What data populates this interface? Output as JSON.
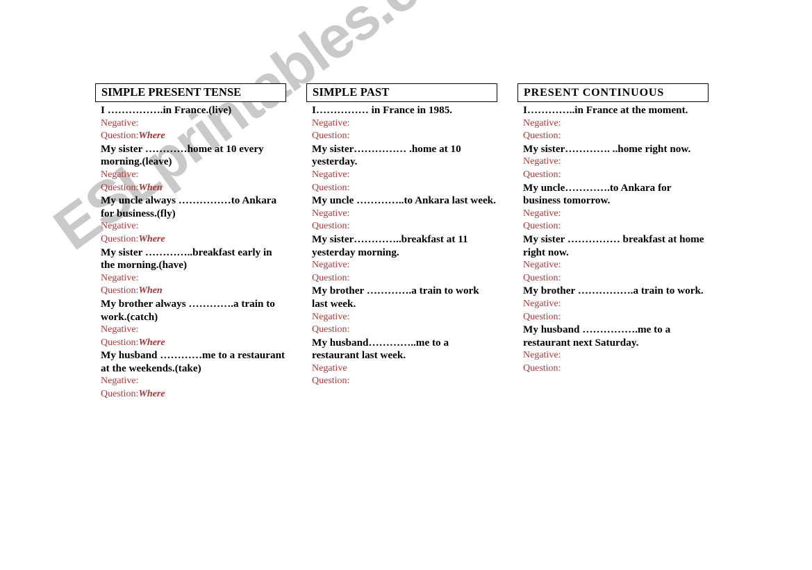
{
  "watermark": {
    "text": "ESLprintables.com"
  },
  "colors": {
    "prompt_red": "#b03a3a",
    "question_word_red": "#a83232",
    "text_black": "#000000",
    "border_black": "#000000",
    "watermark_gray": "#c9c9c9",
    "page_background": "#ffffff"
  },
  "columns": [
    {
      "header": "SIMPLE PRESENT TENSE",
      "entries": [
        {
          "sentence": "I …………….in France.(live)",
          "negative_label": "Negative:",
          "question_label": "Question:",
          "question_word": "Where"
        },
        {
          "sentence": "My sister …………home at 10 every morning.(leave)",
          "negative_label": "Negative:",
          "question_label": "Question:",
          "question_word": "When"
        },
        {
          "sentence": "My uncle always ……………to Ankara for business.(fly)",
          "negative_label": "Negative:",
          "question_label": "Question:",
          "question_word": "Where"
        },
        {
          "sentence": "My sister …………..breakfast early in the morning.(have)",
          "negative_label": "Negative:",
          "question_label": "Question:",
          "question_word": "When"
        },
        {
          "sentence": "My brother always ………….a train to work.(catch)",
          "negative_label": "Negative:",
          "question_label": "Question:",
          "question_word": "Where"
        },
        {
          "sentence": "My husband …………me to a restaurant at the weekends.(take)",
          "negative_label": "Negative:",
          "question_label": "Question:",
          "question_word": "Where"
        }
      ]
    },
    {
      "header": "SIMPLE PAST",
      "entries": [
        {
          "sentence": "I…………… in France in 1985.",
          "negative_label": "Negative:",
          "question_label": "Question:",
          "question_word": ""
        },
        {
          "sentence": "My sister…………… .home at 10 yesterday.",
          "negative_label": "Negative:",
          "question_label": "Question:",
          "question_word": ""
        },
        {
          "sentence": "My uncle …………..to Ankara last week.",
          "negative_label": "Negative:",
          "question_label": "Question:",
          "question_word": ""
        },
        {
          "sentence": "My sister…………..breakfast at 11 yesterday morning.",
          "negative_label": "Negative:",
          "question_label": "Question:",
          "question_word": ""
        },
        {
          "sentence": "My brother ………….a train to work last week.",
          "negative_label": "Negative:",
          "question_label": "Question:",
          "question_word": ""
        },
        {
          "sentence": "My husband…………..me to a restaurant last week.",
          "negative_label": "Negative",
          "question_label": "Question:",
          "question_word": ""
        }
      ]
    },
    {
      "header": "PRESENT CONTINUOUS",
      "entries": [
        {
          "sentence": "I…………..in France at the moment.",
          "negative_label": "Negative:",
          "question_label": "Question:",
          "question_word": ""
        },
        {
          "sentence": "My sister…………. ..home right now.",
          "negative_label": "Negative:",
          "question_label": "Question:",
          "question_word": ""
        },
        {
          "sentence": "My uncle………….to Ankara for business tomorrow.",
          "negative_label": "Negative:",
          "question_label": "Question:",
          "question_word": ""
        },
        {
          "sentence": "My sister …………… breakfast at home right now.",
          "negative_label": "Negative:",
          "question_label": "Question:",
          "question_word": ""
        },
        {
          "sentence": "My brother …………….a train to work.",
          "negative_label": "Negative:",
          "question_label": "Question:",
          "question_word": ""
        },
        {
          "sentence": "My husband …………….me to a restaurant next Saturday.",
          "negative_label": "Negative:",
          "question_label": "Question:",
          "question_word": ""
        }
      ]
    }
  ]
}
